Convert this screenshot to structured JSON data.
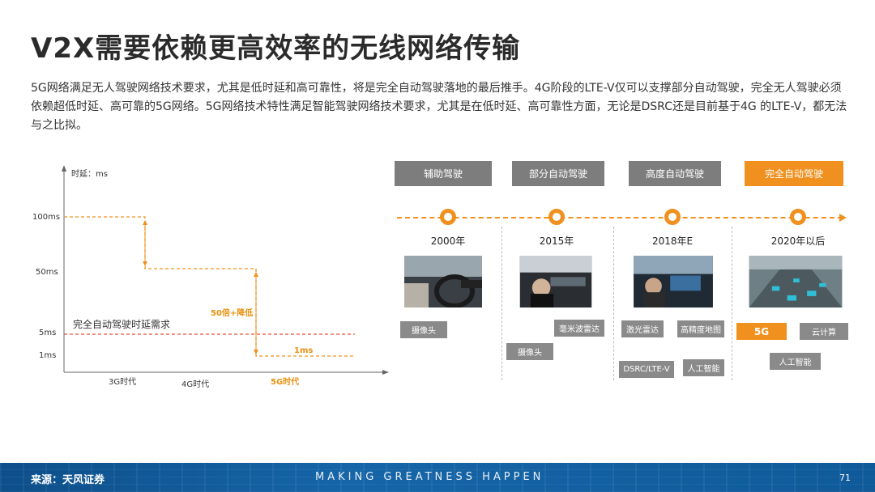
{
  "title": "V2X需要依赖更高效率的无线网络传输",
  "description": "5G网络满足无人驾驶网络技术要求，尤其是低时延和高可靠性，将是完全自动驾驶落地的最后推手。4G阶段的LTE-V仅可以支撑部分自动驾驶，完全无人驾驶必须依赖超低时延、高可靠的5G网络。5G网络技术特性满足智能驾驶网络技术要求，尤其是在低时延、高可靠性方面，无论是DSRC还是目前基于4G 的LTE-V，都无法与之比拟。",
  "chart": {
    "y_axis_label": "时延：ms",
    "y_ticks": [
      "100ms",
      "50ms",
      "5ms",
      "1ms"
    ],
    "x_labels": [
      "3G时代",
      "4G时代",
      "5G时代"
    ],
    "requirement_label": "完全自动驾驶时延需求",
    "annotation_drop": "50倍+降低",
    "annotation_1ms": "1ms"
  },
  "timeline": {
    "stages": [
      "辅助驾驶",
      "部分自动驾驶",
      "高度自动驾驶",
      "完全自动驾驶"
    ],
    "years": [
      "2000年",
      "2015年",
      "2018年E",
      "2020年以后"
    ],
    "tags": {
      "y2000": [
        "摄像头"
      ],
      "y2015": [
        "毫米波雷达",
        "摄像头"
      ],
      "y2018": [
        "激光雷达",
        "高精度地图",
        "DSRC/LTE-V",
        "人工智能"
      ],
      "y2020": [
        "5G",
        "云计算",
        "人工智能"
      ]
    }
  },
  "footer": {
    "source": "来源：天风证券",
    "slogan": "MAKING GREATNESS HAPPEN",
    "page": "71"
  },
  "colors": {
    "accent": "#f0901e",
    "stage_gray": "#7d7d7d",
    "tag_gray": "#8a8a8a",
    "footer_blue": "#1565a8"
  }
}
